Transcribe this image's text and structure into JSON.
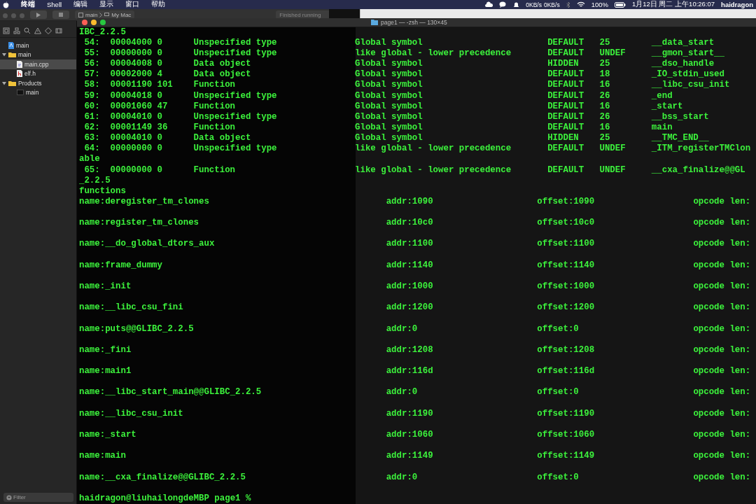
{
  "menubar": {
    "menus": [
      "终端",
      "Shell",
      "编辑",
      "显示",
      "窗口",
      "帮助"
    ],
    "status": {
      "net_up": "0KB/s",
      "net_down": "0KB/s",
      "battery": "100%",
      "clock": "1月12日 周二 上午10:26:07",
      "user": "haidragon"
    }
  },
  "xcode": {
    "scheme": "main",
    "destination": "My Mac",
    "activity": "Finished running",
    "tree": [
      {
        "label": "main",
        "kind": "project",
        "selected": false
      },
      {
        "label": "main",
        "kind": "folder",
        "selected": false,
        "expanded": true,
        "children": [
          {
            "label": "main.cpp",
            "kind": "source",
            "selected": true
          },
          {
            "label": "elf.h",
            "kind": "header",
            "selected": false
          }
        ]
      },
      {
        "label": "Products",
        "kind": "folder",
        "selected": false,
        "expanded": true,
        "children": [
          {
            "label": "main",
            "kind": "executable",
            "selected": false
          }
        ]
      }
    ],
    "filter": {
      "placeholder": "Filter"
    }
  },
  "terminal": {
    "title": "page1 — -zsh — 130×45",
    "lines": [
      {
        "kind": "text",
        "text": "IBC_2.2.5"
      },
      {
        "kind": "symbol",
        "num": "54:",
        "value": "00004000",
        "size": "0",
        "type": "Unspecified type",
        "bind": "Global symbol",
        "vis": "DEFAULT",
        "ndx": "25",
        "name": "__data_start"
      },
      {
        "kind": "symbol",
        "num": "55:",
        "value": "00000000",
        "size": "0",
        "type": "Unspecified type",
        "bind": "like global - lower precedence",
        "vis": "DEFAULT",
        "ndx": "UNDEF",
        "name": "__gmon_start__"
      },
      {
        "kind": "symbol",
        "num": "56:",
        "value": "00004008",
        "size": "0",
        "type": "Data object",
        "bind": "Global symbol",
        "vis": "HIDDEN",
        "ndx": "25",
        "name": "__dso_handle"
      },
      {
        "kind": "symbol",
        "num": "57:",
        "value": "00002000",
        "size": "4",
        "type": "Data object",
        "bind": "Global symbol",
        "vis": "DEFAULT",
        "ndx": "18",
        "name": "_IO_stdin_used"
      },
      {
        "kind": "symbol",
        "num": "58:",
        "value": "00001190",
        "size": "101",
        "type": "Function",
        "bind": "Global symbol",
        "vis": "DEFAULT",
        "ndx": "16",
        "name": "__libc_csu_init"
      },
      {
        "kind": "symbol",
        "num": "59:",
        "value": "00004018",
        "size": "0",
        "type": "Unspecified type",
        "bind": "Global symbol",
        "vis": "DEFAULT",
        "ndx": "26",
        "name": "_end"
      },
      {
        "kind": "symbol",
        "num": "60:",
        "value": "00001060",
        "size": "47",
        "type": "Function",
        "bind": "Global symbol",
        "vis": "DEFAULT",
        "ndx": "16",
        "name": "_start"
      },
      {
        "kind": "symbol",
        "num": "61:",
        "value": "00004010",
        "size": "0",
        "type": "Unspecified type",
        "bind": "Global symbol",
        "vis": "DEFAULT",
        "ndx": "26",
        "name": "__bss_start"
      },
      {
        "kind": "symbol",
        "num": "62:",
        "value": "00001149",
        "size": "36",
        "type": "Function",
        "bind": "Global symbol",
        "vis": "DEFAULT",
        "ndx": "16",
        "name": "main"
      },
      {
        "kind": "symbol",
        "num": "63:",
        "value": "00004010",
        "size": "0",
        "type": "Data object",
        "bind": "Global symbol",
        "vis": "HIDDEN",
        "ndx": "25",
        "name": "__TMC_END__"
      },
      {
        "kind": "symbol",
        "num": "64:",
        "value": "00000000",
        "size": "0",
        "type": "Unspecified type",
        "bind": "like global - lower precedence",
        "vis": "DEFAULT",
        "ndx": "UNDEF",
        "name": "_ITM_registerTMClon"
      },
      {
        "kind": "text",
        "text": "able"
      },
      {
        "kind": "symbol",
        "num": "65:",
        "value": "00000000",
        "size": "0",
        "type": "Function",
        "bind": "like global - lower precedence",
        "vis": "DEFAULT",
        "ndx": "UNDEF",
        "name": "__cxa_finalize@@GL"
      },
      {
        "kind": "text",
        "text": "_2.2.5"
      },
      {
        "kind": "text",
        "text": "functions"
      },
      {
        "kind": "function",
        "name": "name:deregister_tm_clones",
        "addr": "addr:1090",
        "offset": "offset:1090",
        "opcode": "opcode len:"
      },
      {
        "kind": "function",
        "name": "name:register_tm_clones",
        "addr": "addr:10c0",
        "offset": "offset:10c0",
        "opcode": "opcode len:"
      },
      {
        "kind": "function",
        "name": "name:__do_global_dtors_aux",
        "addr": "addr:1100",
        "offset": "offset:1100",
        "opcode": "opcode len:"
      },
      {
        "kind": "function",
        "name": "name:frame_dummy",
        "addr": "addr:1140",
        "offset": "offset:1140",
        "opcode": "opcode len:"
      },
      {
        "kind": "function",
        "name": "name:_init",
        "addr": "addr:1000",
        "offset": "offset:1000",
        "opcode": "opcode len:"
      },
      {
        "kind": "function",
        "name": "name:__libc_csu_fini",
        "addr": "addr:1200",
        "offset": "offset:1200",
        "opcode": "opcode len:"
      },
      {
        "kind": "function",
        "name": "name:puts@@GLIBC_2.2.5",
        "addr": "addr:0",
        "offset": "offset:0",
        "opcode": "opcode len:"
      },
      {
        "kind": "function",
        "name": "name:_fini",
        "addr": "addr:1208",
        "offset": "offset:1208",
        "opcode": "opcode len:"
      },
      {
        "kind": "function",
        "name": "name:main1",
        "addr": "addr:116d",
        "offset": "offset:116d",
        "opcode": "opcode len:"
      },
      {
        "kind": "function",
        "name": "name:__libc_start_main@@GLIBC_2.2.5",
        "addr": "addr:0",
        "offset": "offset:0",
        "opcode": "opcode len:"
      },
      {
        "kind": "function",
        "name": "name:__libc_csu_init",
        "addr": "addr:1190",
        "offset": "offset:1190",
        "opcode": "opcode len:"
      },
      {
        "kind": "function",
        "name": "name:_start",
        "addr": "addr:1060",
        "offset": "offset:1060",
        "opcode": "opcode len:"
      },
      {
        "kind": "function",
        "name": "name:main",
        "addr": "addr:1149",
        "offset": "offset:1149",
        "opcode": "opcode len:"
      },
      {
        "kind": "function",
        "name": "name:__cxa_finalize@@GLIBC_2.2.5",
        "addr": "addr:0",
        "offset": "offset:0",
        "opcode": "opcode len:"
      },
      {
        "kind": "prompt",
        "text": "haidragon@liuhailongdeMBP page1 %"
      }
    ]
  }
}
